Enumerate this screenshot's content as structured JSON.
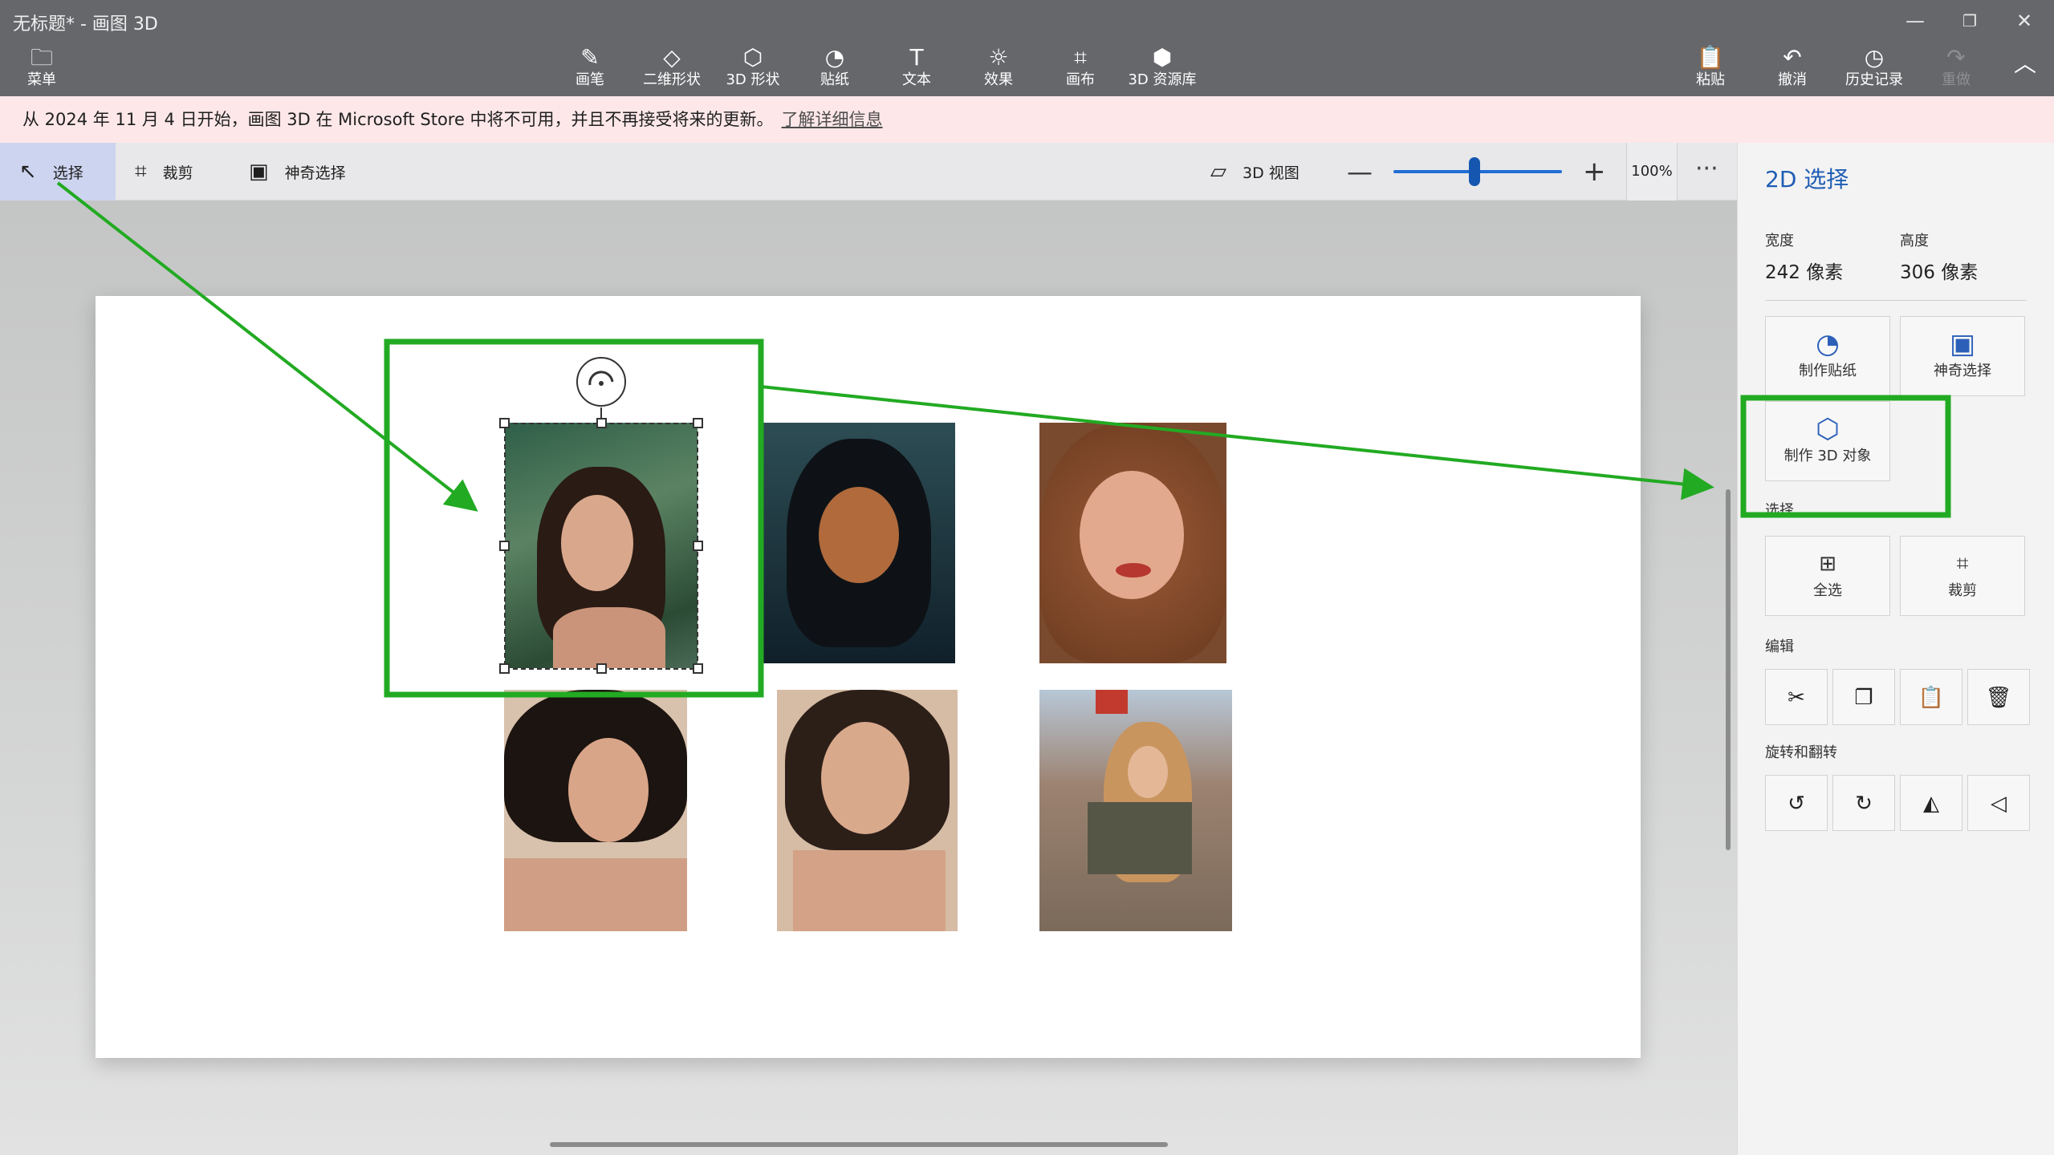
{
  "app": {
    "title": "无标题* - 画图 3D",
    "window_controls": [
      "—",
      "❐",
      "✕"
    ]
  },
  "ribbon": {
    "menu": {
      "label": "菜单",
      "icon": "folder-icon"
    },
    "tools": [
      {
        "label": "画笔",
        "icon": "brush-icon"
      },
      {
        "label": "二维形状",
        "icon": "2d-shapes-icon"
      },
      {
        "label": "3D 形状",
        "icon": "3d-shapes-icon"
      },
      {
        "label": "贴纸",
        "icon": "sticker-icon"
      },
      {
        "label": "文本",
        "icon": "text-icon"
      },
      {
        "label": "效果",
        "icon": "effects-icon"
      },
      {
        "label": "画布",
        "icon": "canvas-icon"
      },
      {
        "label": "3D 资源库",
        "icon": "3d-library-icon"
      }
    ],
    "actions": [
      {
        "label": "粘贴",
        "icon": "paste-icon"
      },
      {
        "label": "撤消",
        "icon": "undo-icon"
      },
      {
        "label": "历史记录",
        "icon": "history-icon"
      },
      {
        "label": "重做",
        "icon": "redo-icon",
        "disabled": true
      }
    ]
  },
  "notice": {
    "text": "从 2024 年 11 月 4 日开始，画图 3D 在 Microsoft Store 中将不可用，并且不再接受将来的更新。",
    "link": "了解详细信息"
  },
  "toolbar": {
    "select": "选择",
    "crop": "裁剪",
    "magic_select": "神奇选择",
    "view3d": "3D 视图",
    "zoom_minus": "—",
    "zoom_plus": "+",
    "zoom_level": "100%",
    "zoom_fraction": 0.48,
    "more": "···"
  },
  "panel": {
    "title": "2D 选择",
    "width_label": "宽度",
    "width_value": "242 像素",
    "height_label": "高度",
    "height_value": "306 像素",
    "make_sticker": "制作贴纸",
    "magic_select": "神奇选择",
    "make_3d": "制作 3D 对象",
    "select_section": "选择",
    "select_all": "全选",
    "crop": "裁剪",
    "edit_section": "编辑",
    "rotate_section": "旋转和翻转"
  },
  "colors": {
    "annotation_green": "#22aa22",
    "accent_blue": "#1f5db5",
    "ribbon_bg": "#66676b",
    "notice_bg": "#fde7e9"
  }
}
